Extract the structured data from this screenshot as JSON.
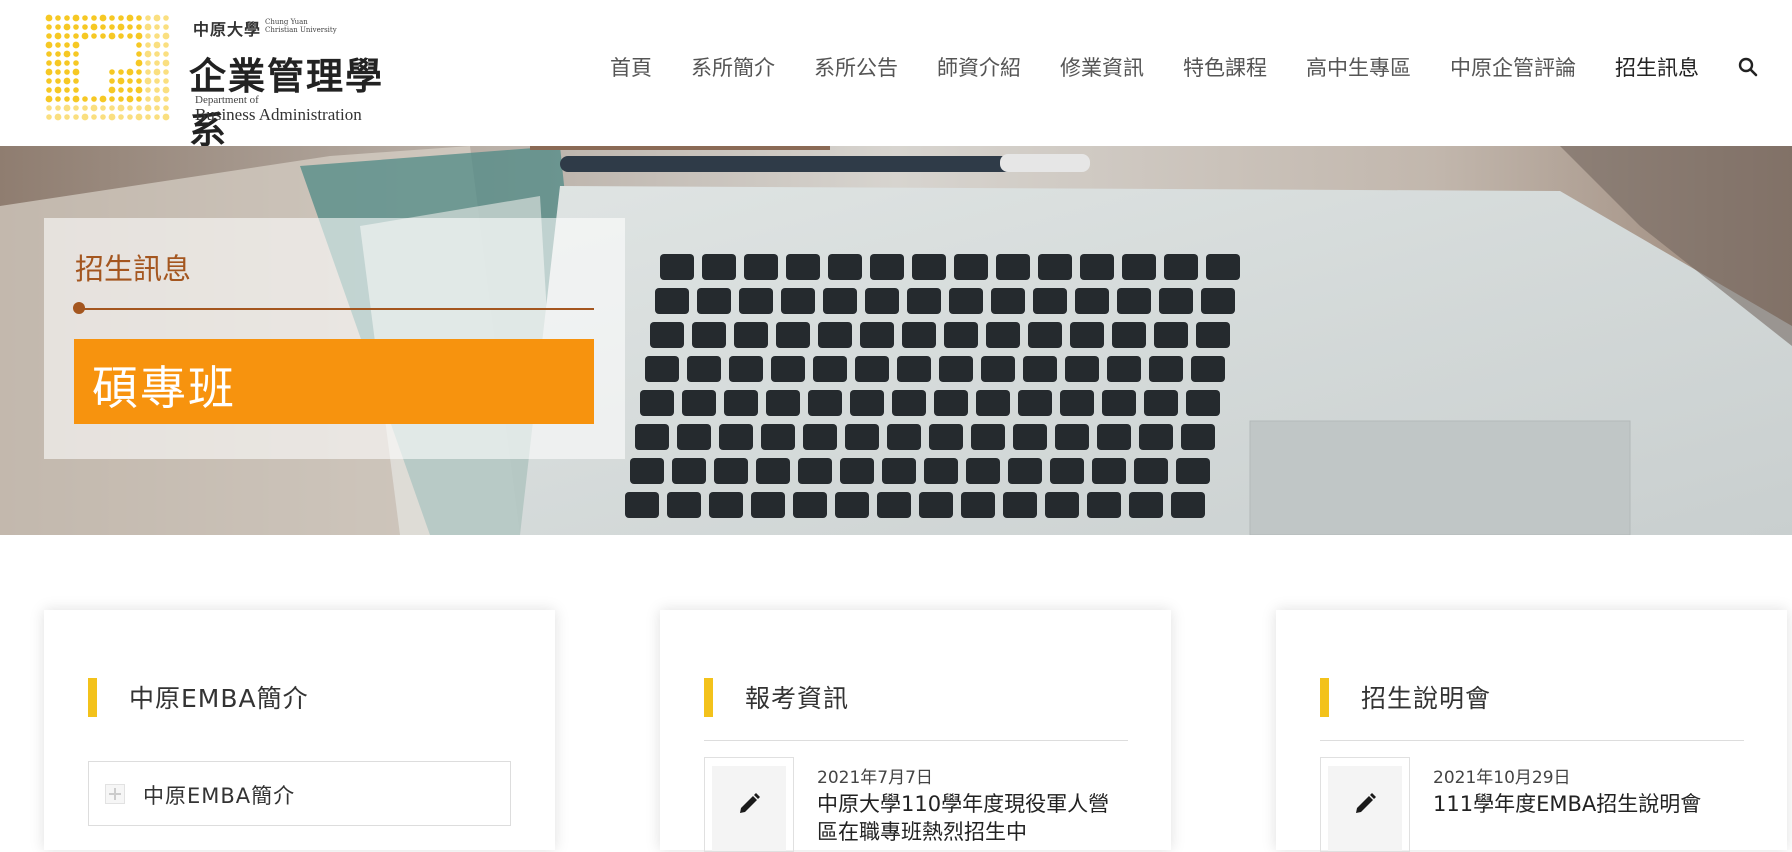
{
  "logo": {
    "university_zh": "中原大學",
    "university_en_line1": "Chung Yuan",
    "university_en_line2": "Christian University",
    "dept_zh": "企業管理學系",
    "dept_en_line1": "Department of",
    "dept_en_line2": "Business Administration"
  },
  "nav": {
    "items": [
      {
        "label": "首頁"
      },
      {
        "label": "系所簡介"
      },
      {
        "label": "系所公告"
      },
      {
        "label": "師資介紹"
      },
      {
        "label": "修業資訊"
      },
      {
        "label": "特色課程"
      },
      {
        "label": "高中生專區"
      },
      {
        "label": "中原企管評論"
      },
      {
        "label": "招生訊息"
      }
    ],
    "search_icon": "search-icon"
  },
  "hero": {
    "category": "招生訊息",
    "title": "碩專班",
    "accent_color": "#f7930e",
    "category_color": "#a4561f"
  },
  "cards": [
    {
      "title": "中原EMBA簡介",
      "accordion_label": "中原EMBA簡介"
    },
    {
      "title": "報考資訊",
      "post_date": "2021年7月7日",
      "post_title": "中原大學110學年度現役軍人營區在職專班熱烈招生中"
    },
    {
      "title": "招生說明會",
      "post_date": "2021年10月29日",
      "post_title": "111學年度EMBA招生說明會"
    }
  ],
  "colors": {
    "card_marker": "#f3c21b",
    "logo_gold": "#f5c518"
  }
}
